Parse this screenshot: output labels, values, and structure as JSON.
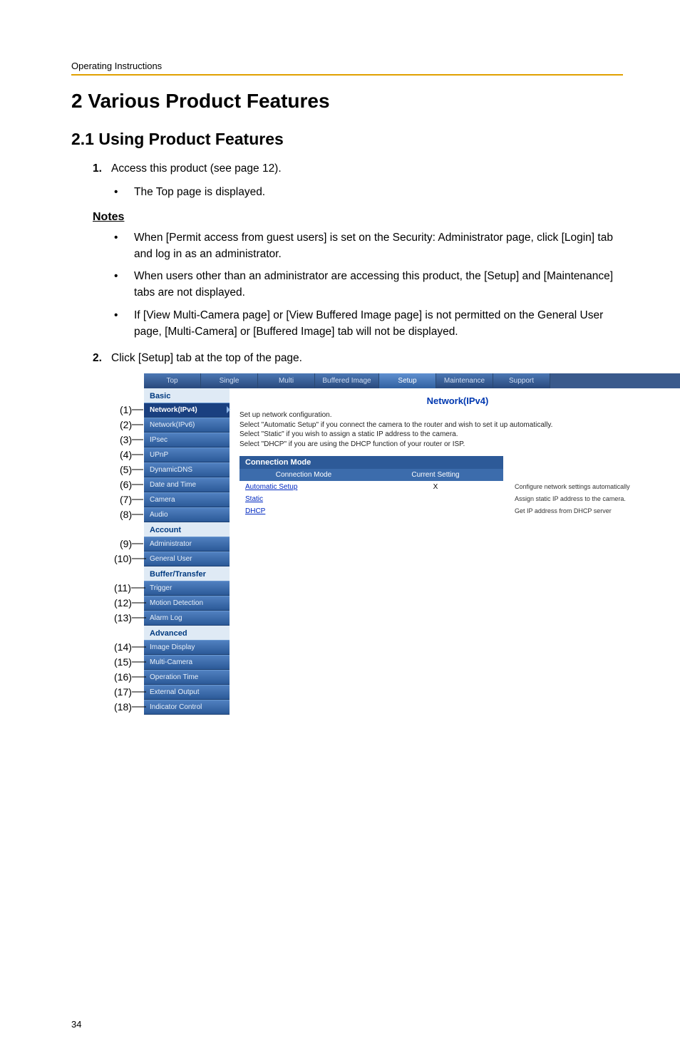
{
  "header": "Operating Instructions",
  "h1": "2    Various Product Features",
  "h2": "2.1   Using Product Features",
  "step1": "Access this product (see page 12).",
  "step1_sub": "The Top page is displayed.",
  "notes_label": "Notes",
  "notes": [
    "When [Permit access from guest users] is set on the Security: Administrator page, click [Login] tab and log in as an administrator.",
    "When users other than an administrator are accessing this product, the [Setup] and [Maintenance] tabs are not displayed.",
    "If [View Multi-Camera page] or [View Buffered Image page] is not permitted on the General User page, [Multi-Camera] or [Buffered Image] tab will not be displayed."
  ],
  "step2": "Click [Setup] tab at the top of the page.",
  "page_number": "34",
  "tabs": [
    "Top",
    "Single",
    "Multi",
    "Buffered Image",
    "Setup",
    "Maintenance",
    "Support"
  ],
  "sidebar": {
    "Basic": [
      "Network(IPv4)",
      "Network(IPv6)",
      "IPsec",
      "UPnP",
      "DynamicDNS",
      "Date and Time",
      "Camera",
      "Audio"
    ],
    "Account": [
      "Administrator",
      "General User"
    ],
    "Buffer/Transfer": [
      "Trigger",
      "Motion Detection",
      "Alarm Log"
    ],
    "Advanced": [
      "Image Display",
      "Multi-Camera",
      "Operation Time",
      "External Output",
      "Indicator Control"
    ]
  },
  "content": {
    "title": "Network(IPv4)",
    "desc": "Set up network configuration.\nSelect \"Automatic Setup\" if you connect the camera to the router and wish to set it up automatically.\nSelect \"Static\" if you wish to assign a static IP address to the camera.\nSelect \"DHCP\" if you are using the DHCP function of your router or ISP.",
    "cm_heading": "Connection Mode",
    "th1": "Connection Mode",
    "th2": "Current Setting",
    "rows": [
      {
        "mode": "Automatic Setup",
        "current": "X",
        "note": "Configure network settings automatically"
      },
      {
        "mode": "Static",
        "current": "",
        "note": "Assign static IP address to the camera."
      },
      {
        "mode": "DHCP",
        "current": "",
        "note": "Get IP address from DHCP server"
      }
    ]
  }
}
